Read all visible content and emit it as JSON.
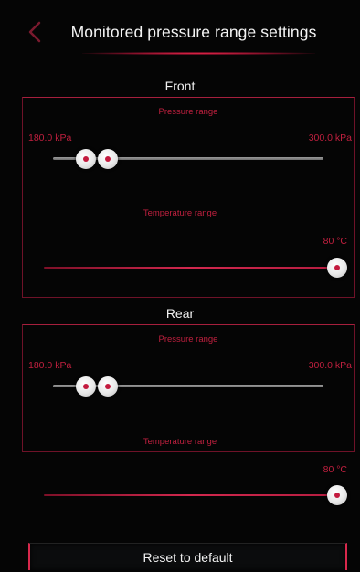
{
  "header": {
    "title": "Monitored pressure range settings",
    "back_icon": "chevron-left-icon"
  },
  "front": {
    "title": "Front",
    "pressure": {
      "caption": "Pressure range",
      "min_label": "180.0 kPa",
      "max_label": "300.0 kPa",
      "min_value_fraction": 0.12,
      "max_value_fraction": 0.19
    },
    "temperature": {
      "caption": "Temperature range",
      "value_label": "80 °C",
      "value_fraction": 1.0
    }
  },
  "rear": {
    "title": "Rear",
    "pressure": {
      "caption": "Pressure range",
      "min_label": "180.0 kPa",
      "max_label": "300.0 kPa",
      "min_value_fraction": 0.12,
      "max_value_fraction": 0.19
    },
    "temperature": {
      "caption": "Temperature range",
      "value_label": "80 °C",
      "value_fraction": 1.0
    }
  },
  "footer": {
    "reset_label": "Reset to default"
  },
  "colors": {
    "accent": "#c0203f",
    "background": "#050505",
    "track_gray": "#8a8a8a"
  }
}
